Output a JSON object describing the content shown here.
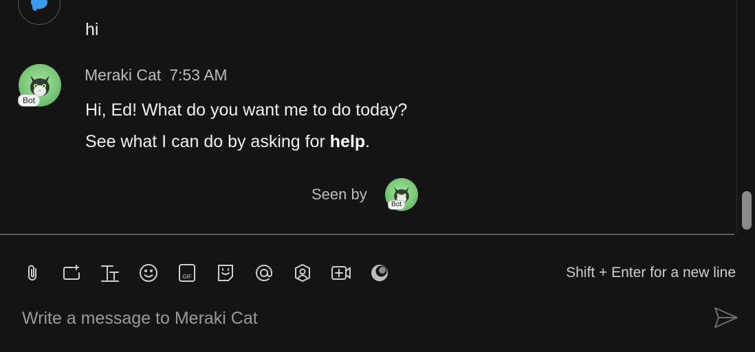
{
  "previous_message": {
    "text": "hi",
    "avatar_icon": "chat-bubble-icon",
    "avatar_color": "#3c9bf0"
  },
  "bot_message": {
    "sender": "Meraki Cat",
    "timestamp": "7:53 AM",
    "badge": "Bot",
    "line1": "Hi, Ed! What do you want me to do today?",
    "line2_prefix": "See what I can do by asking for ",
    "line2_bold": "help",
    "line2_suffix": ".",
    "avatar_icon": "cat-avatar-icon"
  },
  "seen_by": {
    "label": "Seen by",
    "badge": "Bot"
  },
  "composer": {
    "hint": "Shift + Enter for a new line",
    "placeholder": "Write a message to Meraki Cat",
    "toolbar": [
      "attach-icon",
      "screenshot-icon",
      "format-text-icon",
      "emoji-icon",
      "gif-icon",
      "sticker-icon",
      "mention-icon",
      "contact-icon",
      "video-icon",
      "ai-assistant-icon"
    ]
  },
  "colors": {
    "background": "#141414",
    "text": "#f0f0f0",
    "muted": "#bdbdbd",
    "avatar_green": "#7cc87a"
  }
}
